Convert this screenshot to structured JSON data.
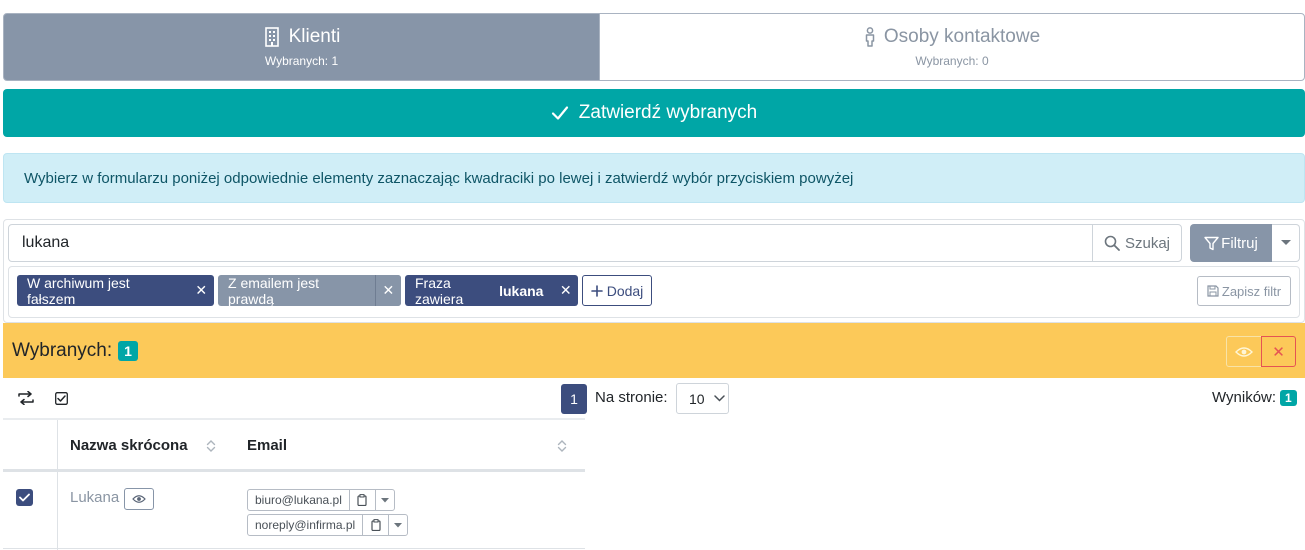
{
  "tabs": [
    {
      "label": "Klienti",
      "sub": "Wybranych: 1",
      "icon": "building-icon"
    },
    {
      "label": "Osoby kontaktowe",
      "sub": "Wybranych: 0",
      "icon": "person-icon"
    }
  ],
  "confirm": {
    "label": "Zatwierdź wybranych"
  },
  "info": {
    "text": "Wybierz w formularzu poniżej odpowiednie elementy zaznaczając kwadraciki po lewej i zatwierdź wybór przyciskiem powyżej"
  },
  "search": {
    "value": "lukana",
    "button": "Szukaj"
  },
  "filter": {
    "button": "Filtruj"
  },
  "chips": [
    {
      "label": "W archiwum jest fałszem"
    },
    {
      "label": "Z emailem jest prawdą"
    },
    {
      "prefix": "Fraza zawiera",
      "value": "lukana"
    }
  ],
  "add": {
    "label": "Dodaj"
  },
  "save_filter": {
    "label": "Zapisz filtr"
  },
  "selected": {
    "label": "Wybranych:",
    "count": "1"
  },
  "pagination": {
    "page": "1",
    "per_page_label": "Na stronie:",
    "per_page": "10"
  },
  "results": {
    "label": "Wyników:",
    "count": "1"
  },
  "table": {
    "columns": [
      "Nazwa skrócona",
      "Email"
    ],
    "rows": [
      {
        "name": "Lukana",
        "emails": [
          "biuro@lukana.pl",
          "noreply@infirma.pl"
        ]
      }
    ]
  },
  "colors": {
    "accent": "#00a6a6",
    "primary": "#3c4d7e",
    "secondary": "#8795a8",
    "warning": "#fcc959",
    "info_bg": "#d0eef7"
  }
}
